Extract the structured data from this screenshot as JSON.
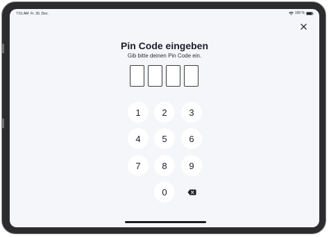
{
  "statusbar": {
    "time": "7:51 AM",
    "date": "Fr. 30. Dez.",
    "battery_percent": "100 %"
  },
  "header": {
    "title": "Pin Code eingeben",
    "subtitle": "Gib bitte deinen Pin Code ein."
  },
  "pin": {
    "digits_entered": 0,
    "length": 4
  },
  "keypad": {
    "keys": [
      "1",
      "2",
      "3",
      "4",
      "5",
      "6",
      "7",
      "8",
      "9",
      "0"
    ],
    "backspace_icon": "backspace-icon"
  },
  "icons": {
    "close": "close-icon",
    "wifi": "wifi-icon",
    "battery": "battery-icon"
  },
  "colors": {
    "background": "#f5f6f9",
    "key_background": "#ffffff",
    "text": "#1c1c2e"
  }
}
